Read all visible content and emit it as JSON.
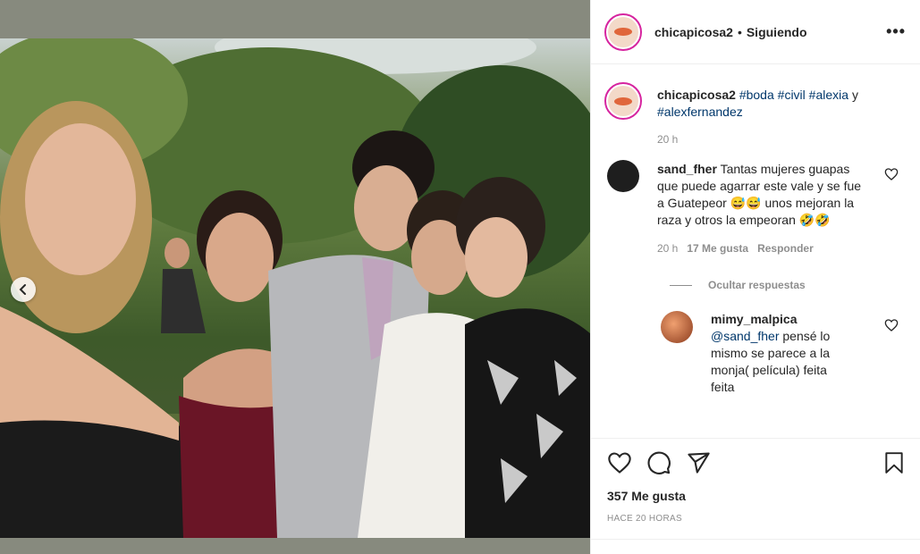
{
  "header": {
    "username": "chicapicosa2",
    "separator": "•",
    "follow_status": "Siguiendo",
    "more_label": "•••"
  },
  "caption": {
    "username": "chicapicosa2",
    "tags": [
      "#boda",
      "#civil",
      "#alexia",
      "y",
      "#alexfernandez"
    ],
    "time": "20 h"
  },
  "comments": [
    {
      "username": "sand_fher",
      "text": "Tantas mujeres guapas que puede agarrar este vale y se fue a Guatepeor 😅😅 unos mejoran la raza y otros la empeoran 🤣🤣",
      "time": "20 h",
      "likes": "17 Me gusta",
      "reply": "Responder",
      "hide_replies": "Ocultar respuestas"
    },
    {
      "username": "mimy_malpica",
      "mention": "@sand_fher",
      "text": "pensé lo mismo se parece a la monja( película) feita feita"
    }
  ],
  "actions": {
    "likes_count": "357 Me gusta",
    "posted_ago": "HACE 20 HORAS"
  },
  "colors": {
    "link": "#00376b",
    "muted": "#8e8e8e",
    "story_ring": "#d6249f"
  },
  "icons": [
    "chevron-left-icon",
    "more-icon",
    "heart-icon",
    "comment-icon",
    "share-icon",
    "bookmark-icon"
  ]
}
